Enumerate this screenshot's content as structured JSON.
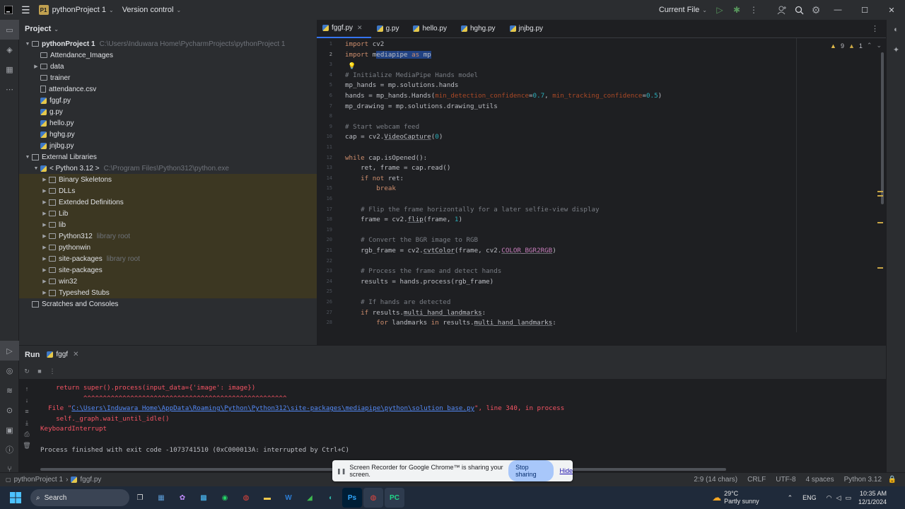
{
  "titlebar": {
    "app_icon": "pycharm-icon",
    "menu_icon": "hamburger-icon",
    "project_badge": "P1",
    "project_name": "pythonProject 1",
    "vcs_label": "Version control",
    "run_config": "Current File",
    "icons": [
      "run-icon",
      "debug-icon",
      "more-icon",
      "add-user-icon",
      "search-icon",
      "settings-icon"
    ],
    "window_controls": [
      "minimize",
      "maximize",
      "close"
    ]
  },
  "project_panel": {
    "title": "Project",
    "tree": [
      {
        "label": "pythonProject 1",
        "hint": "C:\\Users\\Induwara Home\\PycharmProjects\\pythonProject 1",
        "icon": "folder",
        "arrow": "down",
        "level": 0,
        "bold": true
      },
      {
        "label": "Attendance_Images",
        "icon": "folder",
        "arrow": "",
        "level": 1
      },
      {
        "label": "data",
        "icon": "folder",
        "arrow": "right",
        "level": 1
      },
      {
        "label": "trainer",
        "icon": "folder",
        "arrow": "",
        "level": 1
      },
      {
        "label": "attendance.csv",
        "icon": "csv",
        "arrow": "",
        "level": 1
      },
      {
        "label": "fggf.py",
        "icon": "py",
        "arrow": "",
        "level": 1
      },
      {
        "label": "g.py",
        "icon": "py",
        "arrow": "",
        "level": 1
      },
      {
        "label": "hello.py",
        "icon": "py",
        "arrow": "",
        "level": 1
      },
      {
        "label": "hghg.py",
        "icon": "py",
        "arrow": "",
        "level": 1
      },
      {
        "label": "jnjbg.py",
        "icon": "py",
        "arrow": "",
        "level": 1
      },
      {
        "label": "External Libraries",
        "icon": "lib",
        "arrow": "down",
        "level": 0
      },
      {
        "label": "< Python 3.12 >",
        "hint": "C:\\Program Files\\Python312\\python.exe",
        "icon": "py",
        "arrow": "down",
        "level": 1
      },
      {
        "label": "Binary Skeletons",
        "icon": "lib",
        "arrow": "right",
        "level": 2,
        "lib": true
      },
      {
        "label": "DLLs",
        "icon": "folder",
        "arrow": "right",
        "level": 2,
        "lib": true
      },
      {
        "label": "Extended Definitions",
        "icon": "lib",
        "arrow": "right",
        "level": 2,
        "lib": true
      },
      {
        "label": "Lib",
        "icon": "folder",
        "arrow": "right",
        "level": 2,
        "lib": true
      },
      {
        "label": "lib",
        "icon": "folder",
        "arrow": "right",
        "level": 2,
        "lib": true
      },
      {
        "label": "Python312",
        "hint": "library root",
        "icon": "folder",
        "arrow": "right",
        "level": 2,
        "lib": true
      },
      {
        "label": "pythonwin",
        "icon": "folder",
        "arrow": "right",
        "level": 2,
        "lib": true
      },
      {
        "label": "site-packages",
        "hint": "library root",
        "icon": "folder",
        "arrow": "right",
        "level": 2,
        "lib": true
      },
      {
        "label": "site-packages",
        "icon": "folder",
        "arrow": "right",
        "level": 2,
        "lib": true
      },
      {
        "label": "win32",
        "icon": "folder",
        "arrow": "right",
        "level": 2,
        "lib": true
      },
      {
        "label": "Typeshed Stubs",
        "icon": "lib",
        "arrow": "right",
        "level": 2,
        "lib": true
      },
      {
        "label": "Scratches and Consoles",
        "icon": "lib",
        "arrow": "",
        "level": 0
      }
    ]
  },
  "tabs": [
    {
      "label": "fggf.py",
      "active": true
    },
    {
      "label": "g.py",
      "active": false
    },
    {
      "label": "hello.py",
      "active": false
    },
    {
      "label": "hghg.py",
      "active": false
    },
    {
      "label": "jnjbg.py",
      "active": false
    }
  ],
  "inspections": {
    "warnings": "9",
    "weak_warnings": "1"
  },
  "code": [
    {
      "n": "1",
      "html": "<span class=\"kw\">import</span> cv2"
    },
    {
      "n": "2",
      "html": "<span class=\"kw\">import</span> m<span class=\"sel\">ediapipe <span class=\"kw\">as</span> mp</span>"
    },
    {
      "n": "3",
      "html": ""
    },
    {
      "n": "4",
      "html": "<span class=\"cm\"># Initialize MediaPipe Hands model</span>"
    },
    {
      "n": "5",
      "html": "mp_hands = mp.solutions.hands"
    },
    {
      "n": "6",
      "html": "hands = mp_hands.Hands(<span class=\"pn\">min_detection_confidence</span>=<span class=\"nu\">0.7</span>, <span class=\"pn\">min_tracking_confidence</span>=<span class=\"nu\">0.5</span>)"
    },
    {
      "n": "7",
      "html": "mp_drawing = mp.solutions.drawing_utils"
    },
    {
      "n": "8",
      "html": ""
    },
    {
      "n": "9",
      "html": "<span class=\"cm\"># Start webcam feed</span>"
    },
    {
      "n": "10",
      "html": "cap = cv2.<span class=\"ul\">VideoCapture</span>(<span class=\"nu\">0</span>)"
    },
    {
      "n": "11",
      "html": ""
    },
    {
      "n": "12",
      "html": "<span class=\"kw\">while</span> cap.isOpened():"
    },
    {
      "n": "13",
      "html": "    ret, frame = cap.read()"
    },
    {
      "n": "14",
      "html": "    <span class=\"kw\">if not</span> ret:"
    },
    {
      "n": "15",
      "html": "        <span class=\"kw\">break</span>"
    },
    {
      "n": "16",
      "html": ""
    },
    {
      "n": "17",
      "html": "    <span class=\"cm\"># Flip the frame horizontally for a later selfie-view display</span>"
    },
    {
      "n": "18",
      "html": "    frame = cv2.<span class=\"ul\">flip</span>(frame, <span class=\"nu\">1</span>)"
    },
    {
      "n": "19",
      "html": ""
    },
    {
      "n": "20",
      "html": "    <span class=\"cm\"># Convert the BGR image to RGB</span>"
    },
    {
      "n": "21",
      "html": "    rgb_frame = cv2.<span class=\"ul\">cvtColor</span>(frame, cv2.<span class=\"cn ul\">COLOR_BGR2RGB</span>)"
    },
    {
      "n": "22",
      "html": ""
    },
    {
      "n": "23",
      "html": "    <span class=\"cm\"># Process the frame and detect hands</span>"
    },
    {
      "n": "24",
      "html": "    results = hands.process(rgb_frame)"
    },
    {
      "n": "25",
      "html": ""
    },
    {
      "n": "26",
      "html": "    <span class=\"cm\"># If hands are detected</span>"
    },
    {
      "n": "27",
      "html": "    <span class=\"kw\">if</span> results.<span class=\"ul\">multi_hand_landmarks</span>:"
    },
    {
      "n": "28",
      "html": "        <span class=\"kw\">for</span> landmarks <span class=\"kw\">in</span> results.<span class=\"ul\">multi_hand_landmarks</span>:"
    }
  ],
  "run_panel": {
    "title": "Run",
    "tab": "fggf",
    "lines": [
      {
        "cls": "err",
        "indent": "    ",
        "text": "return super().process(input_data={'image': image})"
      },
      {
        "cls": "err",
        "indent": "           ",
        "text": "^^^^^^^^^^^^^^^^^^^^^^^^^^^^^^^^^^^^^^^^^^^^^^^^^^^^"
      },
      {
        "cls": "err",
        "indent": "  ",
        "text": "File \"",
        "link": "C:\\Users\\Induwara Home\\AppData\\Roaming\\Python\\Python312\\site-packages\\mediapipe\\python\\solution_base.py",
        "tail": "\", line 340, in process"
      },
      {
        "cls": "err",
        "indent": "    ",
        "text": "self._graph.wait_until_idle()"
      },
      {
        "cls": "err",
        "indent": "",
        "text": "KeyboardInterrupt"
      },
      {
        "cls": "normal",
        "indent": "",
        "text": ""
      },
      {
        "cls": "normal",
        "indent": "",
        "text": "Process finished with exit code -1073741510 (0xC000013A: interrupted by Ctrl+C)"
      }
    ]
  },
  "status_bar": {
    "project": "pythonProject 1",
    "file": "fggf.py",
    "position": "2:9 (14 chars)",
    "line_sep": "CRLF",
    "encoding": "UTF-8",
    "indent": "4 spaces",
    "interpreter": "Python 3.12"
  },
  "share_banner": {
    "message": "Screen Recorder for Google Chrome™ is sharing your screen.",
    "stop_label": "Stop sharing",
    "hide_label": "Hide"
  },
  "taskbar": {
    "search_label": "Search",
    "weather_temp": "29°C",
    "weather_desc": "Partly sunny",
    "lang": "ENG",
    "time": "10:35 AM",
    "date": "12/1/2024"
  }
}
